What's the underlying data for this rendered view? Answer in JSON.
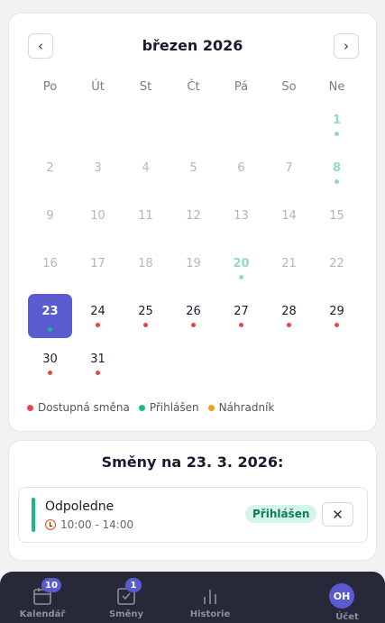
{
  "calendar": {
    "month_title": "březen 2026",
    "prev_label": "‹",
    "next_label": "›",
    "weekdays": [
      "Po",
      "Út",
      "St",
      "Čt",
      "Pá",
      "So",
      "Ne"
    ],
    "days": [
      {
        "num": "",
        "state": "empty",
        "dot": ""
      },
      {
        "num": "",
        "state": "empty",
        "dot": ""
      },
      {
        "num": "",
        "state": "empty",
        "dot": ""
      },
      {
        "num": "",
        "state": "empty",
        "dot": ""
      },
      {
        "num": "",
        "state": "empty",
        "dot": ""
      },
      {
        "num": "",
        "state": "empty",
        "dot": ""
      },
      {
        "num": "1",
        "state": "green",
        "dot": "green"
      },
      {
        "num": "2",
        "state": "past",
        "dot": ""
      },
      {
        "num": "3",
        "state": "past",
        "dot": ""
      },
      {
        "num": "4",
        "state": "past",
        "dot": ""
      },
      {
        "num": "5",
        "state": "past",
        "dot": ""
      },
      {
        "num": "6",
        "state": "past",
        "dot": ""
      },
      {
        "num": "7",
        "state": "past",
        "dot": ""
      },
      {
        "num": "8",
        "state": "green",
        "dot": "green"
      },
      {
        "num": "9",
        "state": "past",
        "dot": ""
      },
      {
        "num": "10",
        "state": "past",
        "dot": ""
      },
      {
        "num": "11",
        "state": "past",
        "dot": ""
      },
      {
        "num": "12",
        "state": "past",
        "dot": ""
      },
      {
        "num": "13",
        "state": "past",
        "dot": ""
      },
      {
        "num": "14",
        "state": "past",
        "dot": ""
      },
      {
        "num": "15",
        "state": "past",
        "dot": ""
      },
      {
        "num": "16",
        "state": "past",
        "dot": ""
      },
      {
        "num": "17",
        "state": "past",
        "dot": ""
      },
      {
        "num": "18",
        "state": "past",
        "dot": ""
      },
      {
        "num": "19",
        "state": "past",
        "dot": ""
      },
      {
        "num": "20",
        "state": "green",
        "dot": "green"
      },
      {
        "num": "21",
        "state": "past",
        "dot": ""
      },
      {
        "num": "22",
        "state": "past",
        "dot": ""
      },
      {
        "num": "23",
        "state": "selected",
        "dot": "green"
      },
      {
        "num": "24",
        "state": "future",
        "dot": "red"
      },
      {
        "num": "25",
        "state": "future",
        "dot": "red"
      },
      {
        "num": "26",
        "state": "future",
        "dot": "red"
      },
      {
        "num": "27",
        "state": "future",
        "dot": "red"
      },
      {
        "num": "28",
        "state": "future",
        "dot": "red"
      },
      {
        "num": "29",
        "state": "future",
        "dot": "red"
      },
      {
        "num": "30",
        "state": "future",
        "dot": "red"
      },
      {
        "num": "31",
        "state": "future",
        "dot": "red"
      }
    ],
    "legend": [
      {
        "label": "Dostupná směna",
        "color": "#e0484f"
      },
      {
        "label": "Přihlášen",
        "color": "#1fb68a"
      },
      {
        "label": "Náhradník",
        "color": "#e9a21a"
      }
    ]
  },
  "shifts": {
    "title": "Směny na 23. 3. 2026:",
    "items": [
      {
        "name": "Odpoledne",
        "time": "10:00 - 14:00",
        "status": "Přihlášen",
        "close": "✕"
      }
    ]
  },
  "bottom_nav": {
    "items": [
      {
        "label": "Kalendář",
        "badge": "10",
        "icon": "calendar-icon"
      },
      {
        "label": "Směny",
        "badge": "1",
        "icon": "checklist-icon"
      },
      {
        "label": "Historie",
        "badge": "",
        "icon": "bar-chart-icon"
      },
      {
        "label": "Účet",
        "avatar": "OH",
        "icon": "avatar"
      }
    ]
  },
  "colors": {
    "accent": "#5b5bd0",
    "available": "#e0484f",
    "registered": "#1fb68a",
    "substitute": "#e9a21a"
  }
}
